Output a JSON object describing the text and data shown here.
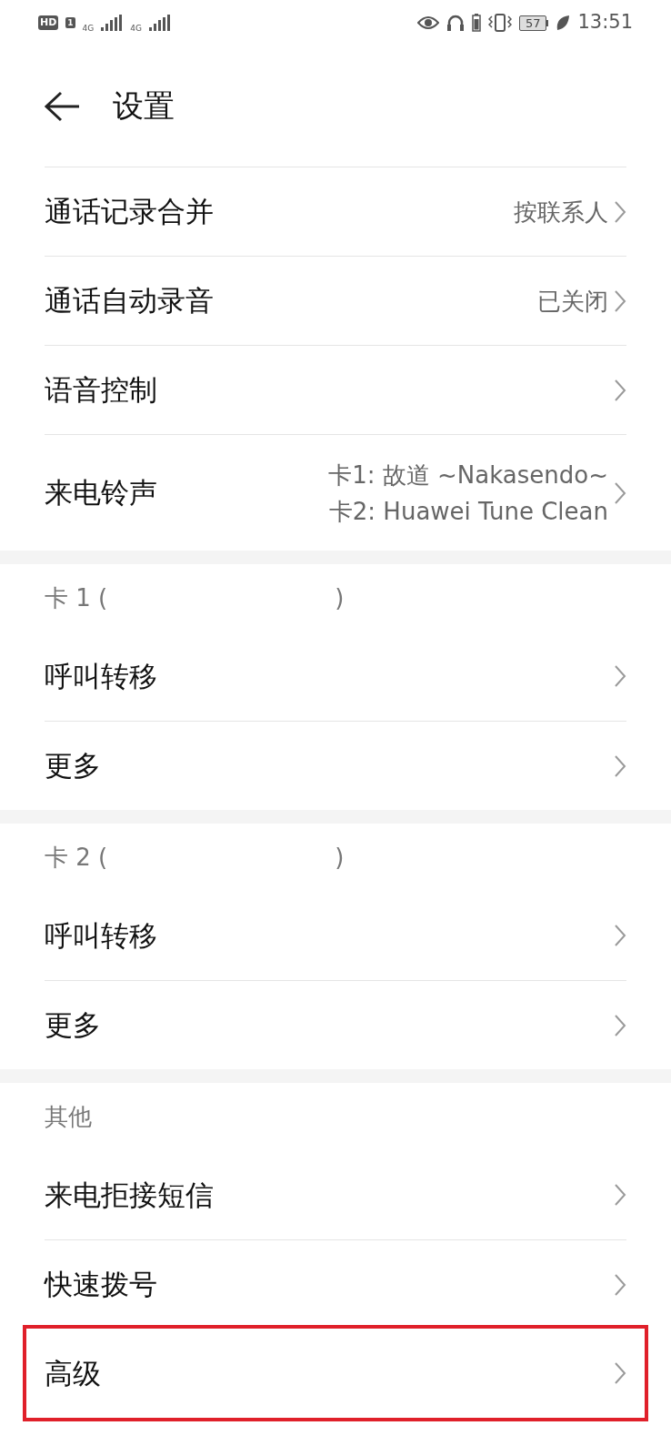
{
  "status_bar": {
    "hd": "HD",
    "sim_slot": "1",
    "network_1": "4G",
    "network_2": "4G",
    "battery": "57",
    "time": "13:51"
  },
  "header": {
    "title": "设置"
  },
  "sections": [
    {
      "items": [
        {
          "label": "通话记录合并",
          "value": [
            "按联系人"
          ],
          "highlighted": false
        },
        {
          "label": "通话自动录音",
          "value": [
            "已关闭"
          ],
          "highlighted": false
        },
        {
          "label": "语音控制",
          "highlighted": false
        },
        {
          "label": "来电铃声",
          "value": [
            "卡1: 故道 ~Nakasendo~",
            "卡2: Huawei Tune Clean"
          ],
          "highlighted": false
        }
      ]
    },
    {
      "header": [
        "卡 1 (",
        ")"
      ],
      "items": [
        {
          "label": "呼叫转移",
          "highlighted": false
        },
        {
          "label": "更多",
          "highlighted": false
        }
      ]
    },
    {
      "header": [
        "卡 2 (",
        ")"
      ],
      "items": [
        {
          "label": "呼叫转移",
          "highlighted": false
        },
        {
          "label": "更多",
          "highlighted": false
        }
      ]
    },
    {
      "header": [
        "其他"
      ],
      "items": [
        {
          "label": "来电拒接短信",
          "highlighted": false
        },
        {
          "label": "快速拨号",
          "highlighted": false
        },
        {
          "label": "高级",
          "highlighted": true
        }
      ]
    }
  ]
}
